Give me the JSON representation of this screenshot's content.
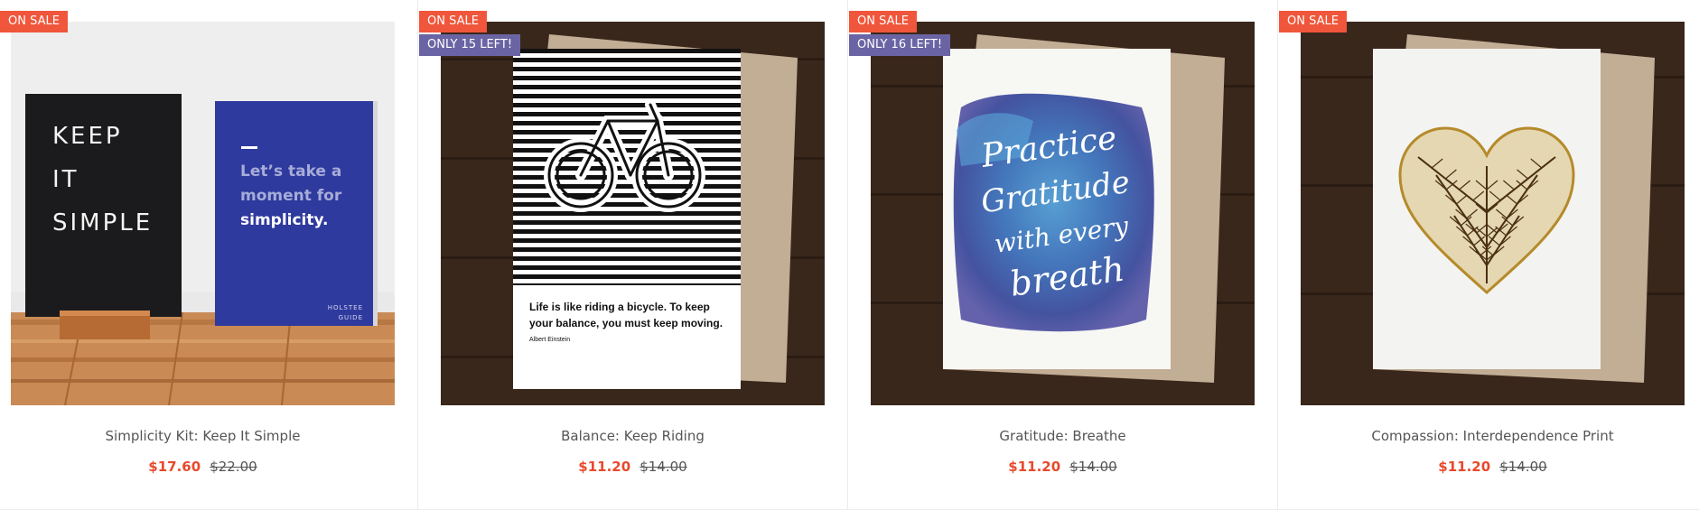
{
  "colors": {
    "sale_badge": "#f0563b",
    "stock_badge": "#6b64a4",
    "sale_price": "#e8492d",
    "wood": "#3a271c",
    "card_blue": "#2f3a9e"
  },
  "products": [
    {
      "badge_sale": "ON SALE",
      "badge_stock": "",
      "title": "Simplicity Kit: Keep It Simple",
      "price": "$17.60",
      "old_price": "$22.00",
      "image": {
        "icon": "letterboard-card-image",
        "board_lines": [
          "KEEP",
          "IT",
          "SIMPLE"
        ],
        "card_lines": [
          "Let’s take a",
          "moment for",
          "simplicity."
        ],
        "card_brand": [
          "HOLSTEE",
          "GUIDE"
        ]
      }
    },
    {
      "badge_sale": "ON SALE",
      "badge_stock": "ONLY 15 LEFT!",
      "title": "Balance: Keep Riding",
      "price": "$11.20",
      "old_price": "$14.00",
      "image": {
        "icon": "bicycle-card-image",
        "quote_lines": [
          "Life is like riding a bicycle. To keep",
          "your balance, you must keep moving."
        ],
        "author": "Albert Einstein"
      }
    },
    {
      "badge_sale": "ON SALE",
      "badge_stock": "ONLY 16 LEFT!",
      "title": "Gratitude: Breathe",
      "price": "$11.20",
      "old_price": "$14.00",
      "image": {
        "icon": "watercolor-card-image",
        "script_lines": [
          "Practice",
          "Gratitude",
          "with every",
          "breath"
        ]
      }
    },
    {
      "badge_sale": "ON SALE",
      "badge_stock": "",
      "title": "Compassion: Interdependence Print",
      "price": "$11.20",
      "old_price": "$14.00",
      "image": {
        "icon": "heart-tree-card-image"
      }
    }
  ]
}
